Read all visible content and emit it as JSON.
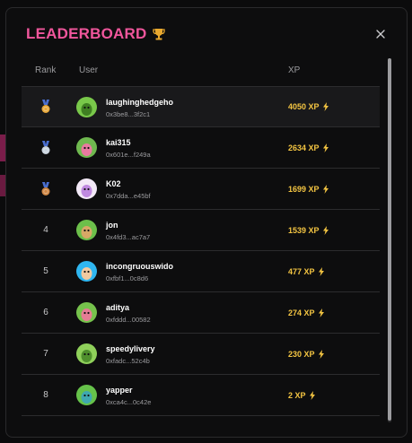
{
  "header": {
    "title": "LEADERBOARD"
  },
  "columns": {
    "rank": "Rank",
    "user": "User",
    "xp": "XP"
  },
  "rows": [
    {
      "rank": "",
      "medal": "gold",
      "username": "laughinghedgeho",
      "address": "0x3be8...3f2c1",
      "xp": "4050 XP",
      "avatar": "#79c84a",
      "avatar_fg": "#3f7f22"
    },
    {
      "rank": "",
      "medal": "silver",
      "username": "kai315",
      "address": "0x601e...f249a",
      "xp": "2634 XP",
      "avatar": "#6fb84f",
      "avatar_fg": "#e87aa0"
    },
    {
      "rank": "",
      "medal": "bronze",
      "username": "K02",
      "address": "0x7dda...e45bf",
      "xp": "1699 XP",
      "avatar": "#f3e9f7",
      "avatar_fg": "#c08ae0"
    },
    {
      "rank": "4",
      "medal": "",
      "username": "jon",
      "address": "0x4fd3...ac7a7",
      "xp": "1539 XP",
      "avatar": "#6cbf4a",
      "avatar_fg": "#d8a866"
    },
    {
      "rank": "5",
      "medal": "",
      "username": "incongruouswido",
      "address": "0xfbf1...0c8d6",
      "xp": "477 XP",
      "avatar": "#2fb6f0",
      "avatar_fg": "#f1c9a0"
    },
    {
      "rank": "6",
      "medal": "",
      "username": "aditya",
      "address": "0xfddd...00582",
      "xp": "274 XP",
      "avatar": "#76c24c",
      "avatar_fg": "#e47d95"
    },
    {
      "rank": "7",
      "medal": "",
      "username": "speedylivery",
      "address": "0xfadc...52c4b",
      "xp": "230 XP",
      "avatar": "#8fd05a",
      "avatar_fg": "#4f8f2d"
    },
    {
      "rank": "8",
      "medal": "",
      "username": "yapper",
      "address": "0xca4c...0c42e",
      "xp": "2 XP",
      "avatar": "#66c24a",
      "avatar_fg": "#3fa8b0"
    }
  ],
  "colors": {
    "title": "#f0569c",
    "xp": "#f4c542",
    "gold": "#e8a83a",
    "silver": "#c9d3de",
    "bronze": "#d08745"
  },
  "icons": {
    "trophy": "trophy-icon",
    "close": "close-icon",
    "bolt": "lightning-icon",
    "medal": "medal-icon"
  }
}
